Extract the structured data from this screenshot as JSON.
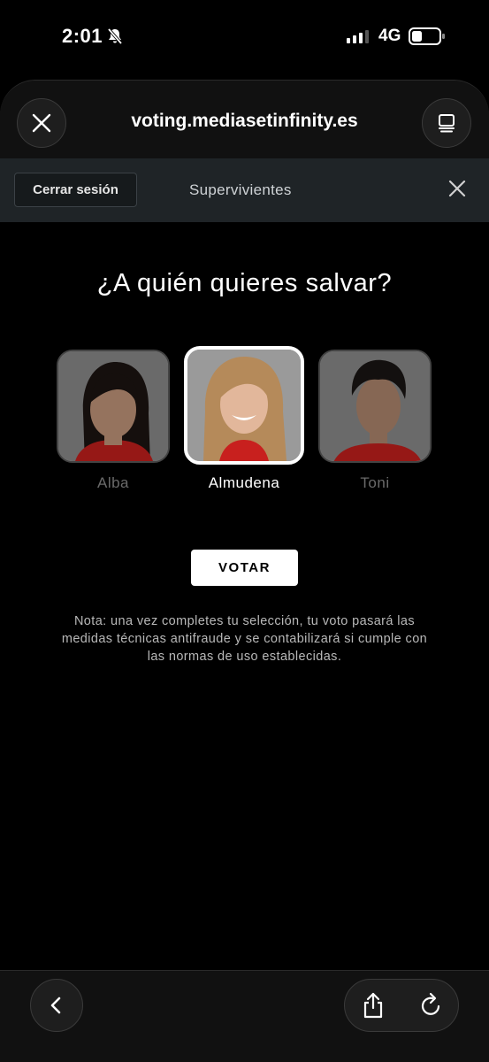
{
  "status_bar": {
    "time": "2:01",
    "network": "4G",
    "icons": [
      "bell-slash-icon",
      "signal-icon",
      "battery-icon"
    ]
  },
  "browser": {
    "url": "voting.mediasetinfinity.es",
    "icons": [
      "close-icon",
      "tabs-icon",
      "back-icon",
      "share-icon",
      "reload-icon"
    ]
  },
  "site_nav": {
    "logout_label": "Cerrar sesión",
    "show_title": "Supervivientes"
  },
  "main": {
    "question": "¿A quién quieres salvar?",
    "candidates": [
      {
        "name": "Alba",
        "selected": false
      },
      {
        "name": "Almudena",
        "selected": true
      },
      {
        "name": "Toni",
        "selected": false
      }
    ],
    "vote_label": "VOTAR",
    "note": "Nota: una vez completes tu selección, tu voto pasará las medidas técnicas antifraude y se contabilizará si cumple con las normas de uso establecidas."
  },
  "colors": {
    "background": "#000000",
    "nav_background": "#1f2427",
    "selected_border": "#ffffff",
    "unselected_name": "#6a6a6a"
  }
}
